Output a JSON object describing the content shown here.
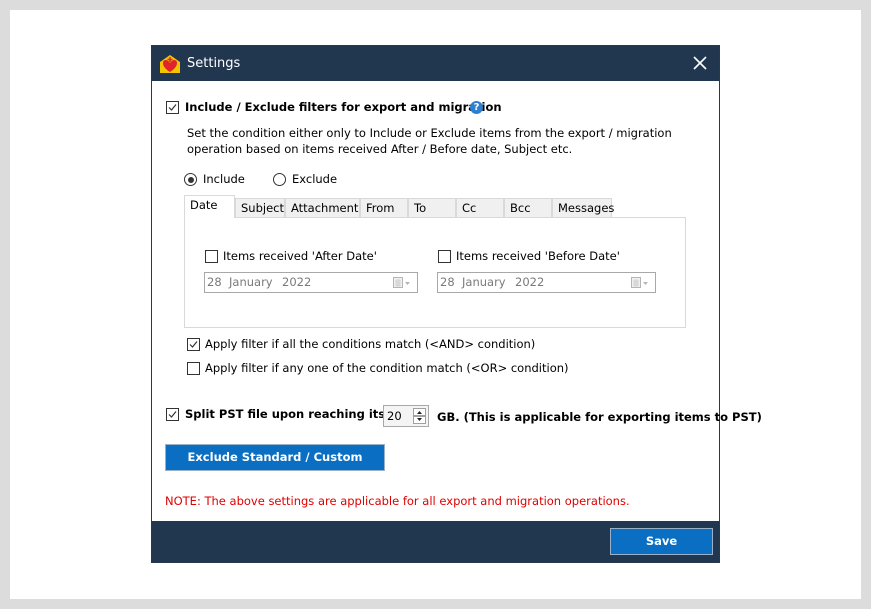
{
  "window": {
    "title": "Settings",
    "close_icon": "close-icon",
    "app_icon": "app-logo-icon"
  },
  "filters": {
    "enable_label": "Include / Exclude filters for export and migration",
    "enable_checked": true,
    "help_icon": "help-icon",
    "help_glyph": "?",
    "description_line1": "Set the condition either only to Include or Exclude items from the export / migration",
    "description_line2": "operation based on items received After / Before date, Subject etc.",
    "mode_options": [
      {
        "label": "Include",
        "selected": true
      },
      {
        "label": "Exclude",
        "selected": false
      }
    ],
    "tabs": [
      {
        "label": "Date",
        "active": true
      },
      {
        "label": "Subject",
        "active": false
      },
      {
        "label": "Attachment",
        "active": false
      },
      {
        "label": "From",
        "active": false
      },
      {
        "label": "To",
        "active": false
      },
      {
        "label": "Cc",
        "active": false
      },
      {
        "label": "Bcc",
        "active": false
      },
      {
        "label": "Messages",
        "active": false
      }
    ],
    "date_tab": {
      "after": {
        "label": "Items received 'After Date'",
        "checked": false,
        "day": "28",
        "month": "January",
        "year": "2022"
      },
      "before": {
        "label": "Items received 'Before Date'",
        "checked": false,
        "day": "28",
        "month": "January",
        "year": "2022"
      }
    },
    "and_condition": {
      "label": "Apply filter if all the conditions match (<AND> condition)",
      "checked": true
    },
    "or_condition": {
      "label": "Apply filter if any one of the condition match (<OR> condition)",
      "checked": false
    }
  },
  "split_pst": {
    "label": "Split PST file upon reaching its size",
    "checked": true,
    "value": "20",
    "suffix": "GB. (This is applicable for exporting items to PST)"
  },
  "exclude_folders_button": "Exclude Standard / Custom folders",
  "note": "NOTE: The above settings are applicable for all export and migration operations.",
  "footer": {
    "save_label": "Save"
  },
  "colors": {
    "titlebar": "#213750",
    "accent_button": "#0a6fc2",
    "note_text": "#e00000"
  }
}
